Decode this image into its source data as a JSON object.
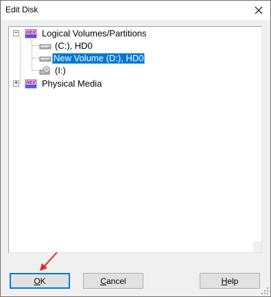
{
  "window": {
    "title": "Edit Disk"
  },
  "tree": {
    "root1": {
      "label": "Logical Volumes/Partitions",
      "expander": "−",
      "children": [
        {
          "label": "(C:), HD0",
          "selected": false
        },
        {
          "label": "New Volume (D:), HD0",
          "selected": true
        },
        {
          "label": "(I:)",
          "selected": false
        }
      ]
    },
    "root2": {
      "label": "Physical Media",
      "expander": "+"
    }
  },
  "buttons": {
    "ok_underline": "O",
    "ok_rest": "K",
    "cancel_underline": "C",
    "cancel_rest": "ancel",
    "help_underline": "H",
    "help_rest": "elp"
  },
  "colors": {
    "selection": "#0078d7",
    "annotation_arrow": "#e8231e"
  }
}
